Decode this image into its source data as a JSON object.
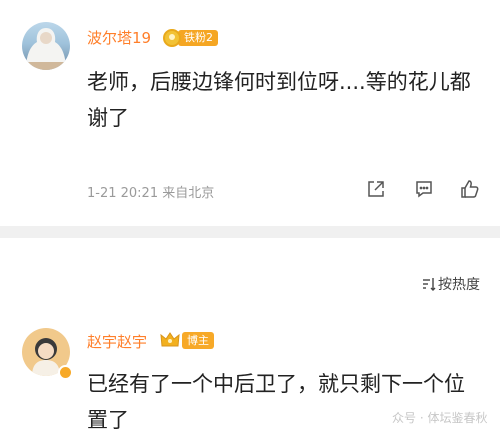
{
  "comments": [
    {
      "user_name": "波尔塔19",
      "fan_badge": "铁粉2",
      "text": "老师，后腰边锋何时到位呀....等的花儿都谢了",
      "meta": "1-21 20:21 来自北京"
    },
    {
      "user_name": "赵宇赵宇",
      "host_badge": "博主",
      "text": "已经有了一个中后卫了，就只剩下一个位置了"
    }
  ],
  "sort_label": "按热度",
  "watermark": "众号 · 体坛鉴春秋",
  "colors": {
    "username": "#ff7f2a",
    "badge": "#f5a623",
    "divider": "#f0f0f0"
  },
  "icons": [
    "share-icon",
    "comment-icon",
    "like-icon",
    "sort-icon",
    "crown-icon",
    "verified-icon"
  ]
}
